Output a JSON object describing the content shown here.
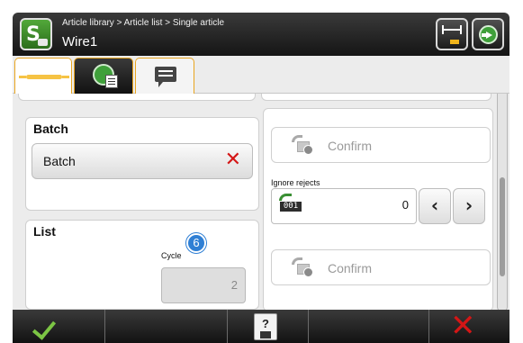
{
  "header": {
    "breadcrumb": "Article library > Article list > Single article",
    "title": "Wire1",
    "app_icon": "s-camera-icon",
    "buttons": [
      {
        "name": "measure-icon"
      },
      {
        "name": "next-arrow-icon"
      }
    ]
  },
  "tabs": [
    {
      "icon": "wire-icon",
      "state": "selected"
    },
    {
      "icon": "green-circle-document-icon",
      "state": "normal"
    },
    {
      "icon": "comment-icon",
      "state": "normal"
    }
  ],
  "batch": {
    "title": "Batch",
    "button_label": "Batch",
    "clear_icon": "red-x-icon"
  },
  "list": {
    "title": "List",
    "cycle_label": "Cycle",
    "cycle_value": "2",
    "badge": "6"
  },
  "right": {
    "confirm_top": "Confirm",
    "ignore_rejects_label": "Ignore rejects",
    "counter_icon_text": "001",
    "ignore_rejects_value": "0",
    "confirm_bottom": "Confirm"
  },
  "arrows": {
    "prev": "‹",
    "next": "›"
  },
  "footer": {
    "accept_icon": "green-check-icon",
    "save_icon": "save-question-icon",
    "save_glyph": "?",
    "cancel_icon": "red-x-icon",
    "cancel_glyph": "✕"
  },
  "colors": {
    "accent_orange": "#e9a51f",
    "confirm_green": "#7cc544",
    "cancel_red": "#d41616",
    "badge_blue": "#2f7fd4"
  }
}
